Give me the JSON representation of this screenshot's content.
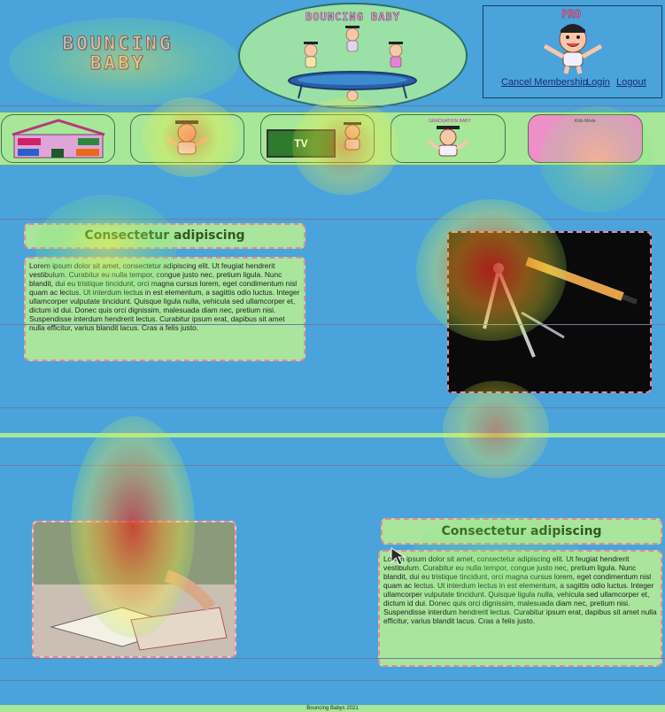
{
  "header": {
    "logo_line1": "BOUNCING",
    "logo_line2": "BABY",
    "oval_title": "BOUNCING BABY",
    "pro_label": "PRO",
    "links": {
      "cancel_membership": "Cancel Membership",
      "login": "Login",
      "logout": "Logout"
    }
  },
  "nav": {
    "tv_label": "TV",
    "kids_mode_label": "Kids Mode",
    "graduation_label": "GRADUATION BABY"
  },
  "sections": [
    {
      "title": "Consectetur adipiscing",
      "body": "Lorem ipsum dolor sit amet, consectetur adipiscing elit. Ut feugiat hendrerit vestibulum. Curabitur eu nulla tempor, congue justo nec, pretium ligula. Nunc blandit, dui eu tristique tincidunt, orci magna cursus lorem, eget condimentum nisl quam ac lectus. Ut interdum lectus in est elementum, a sagittis odio luctus. Integer ullamcorper vulputate tincidunt. Quisque ligula nulla, vehicula sed ullamcorper et, dictum id dui. Donec quis orci dignissim, malesuada diam nec, pretium nisi. Suspendisse interdum hendrerit lectus. Curabitur ipsum erat, dapibus sit amet nulla efficitur, varius blandit lacus. Cras a felis justo."
    },
    {
      "title": "Consectetur adipiscing",
      "body": "Lorem ipsum dolor sit amet, consectetur adipiscing elit. Ut feugiat hendrerit vestibulum. Curabitur eu nulla tempor, congue justo nec, pretium ligula. Nunc blandit, dui eu tristique tincidunt, orci magna cursus lorem, eget condimentum nisl quam ac lectus. Ut interdum lectus in est elementum, a sagittis odio luctus. Integer ullamcorper vulputate tincidunt. Quisque ligula nulla, vehicula sed ullamcorper et, dictum id dui. Donec quis orci dignissim, malesuada diam nec, pretium nisi. Suspendisse interdum hendrerit lectus. Curabitur ipsum erat, dapibus sit amet nulla efficitur, varius blandit lacus. Cras a felis justo."
    }
  ],
  "footer": {
    "text": "Bouncing Babys 2021"
  },
  "colors": {
    "page_bg": "#4aa3db",
    "accent_green": "#a6e79a",
    "dash_pink": "#e5879e",
    "heat_red": "#e0281e",
    "heat_yellow": "#f5ef3c"
  }
}
